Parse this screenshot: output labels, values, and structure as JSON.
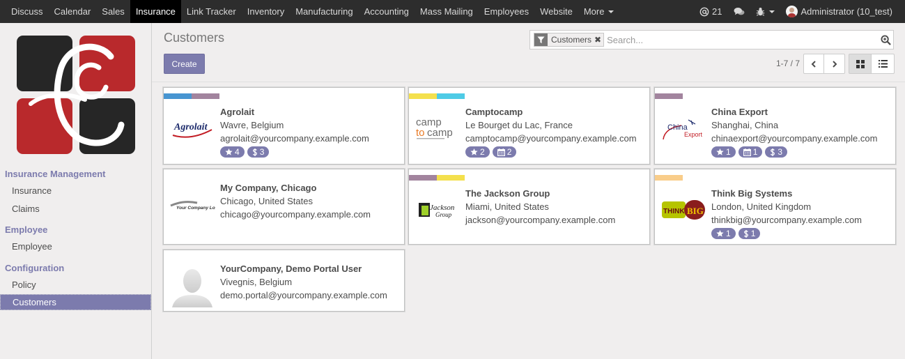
{
  "topbar": {
    "menu": [
      "Discuss",
      "Calendar",
      "Sales",
      "Insurance",
      "Link Tracker",
      "Inventory",
      "Manufacturing",
      "Accounting",
      "Mass Mailing",
      "Employees",
      "Website"
    ],
    "more_label": "More",
    "messages_count": "21",
    "user_label": "Administrator (10_test)"
  },
  "sidebar": {
    "sections": [
      {
        "title": "Insurance Management",
        "items": [
          "Insurance",
          "Claims"
        ]
      },
      {
        "title": "Employee",
        "items": [
          "Employee"
        ]
      },
      {
        "title": "Configuration",
        "items": [
          "Policy",
          "Customers"
        ]
      }
    ]
  },
  "control": {
    "breadcrumb": "Customers",
    "create_label": "Create",
    "facet_label": "Customers",
    "facet_remove": "✖",
    "search_placeholder": "Search...",
    "pager_value": "1-7 / 7"
  },
  "colors": {
    "accent": "#7c7bad",
    "topbar": "#2d2d2d"
  },
  "cards": [
    {
      "name": "Agrolait",
      "location": "Wavre, Belgium",
      "email": "agrolait@yourcompany.example.com",
      "tag_colors": [
        "#4795d1",
        "#a2849e"
      ],
      "logo": "Agrolait",
      "badges": [
        {
          "icon": "star-icon",
          "value": "4"
        },
        {
          "icon": "dollar-icon",
          "value": "3"
        }
      ]
    },
    {
      "name": "Camptocamp",
      "location": "Le Bourget du Lac, France",
      "email": "camptocamp@yourcompany.example.com",
      "tag_colors": [
        "#f4e04d",
        "#4ecbe6"
      ],
      "logo": "camptocamp",
      "badges": [
        {
          "icon": "star-icon",
          "value": "2"
        },
        {
          "icon": "calendar-icon",
          "value": "2"
        }
      ]
    },
    {
      "name": "China Export",
      "location": "Shanghai, China",
      "email": "chinaexport@yourcompany.example.com",
      "tag_colors": [
        "#a2849e"
      ],
      "logo": "ChinaExport",
      "badges": [
        {
          "icon": "star-icon",
          "value": "1"
        },
        {
          "icon": "calendar-icon",
          "value": "1"
        },
        {
          "icon": "dollar-icon",
          "value": "3"
        }
      ]
    },
    {
      "name": "My Company, Chicago",
      "location": "Chicago, United States",
      "email": "chicago@yourcompany.example.com",
      "tag_colors": [],
      "logo": "YourCompanyLogo",
      "badges": []
    },
    {
      "name": "The Jackson Group",
      "location": "Miami, United States",
      "email": "jackson@yourcompany.example.com",
      "tag_colors": [
        "#a2849e",
        "#f4e04d"
      ],
      "logo": "JacksonGroup",
      "badges": []
    },
    {
      "name": "Think Big Systems",
      "location": "London, United Kingdom",
      "email": "thinkbig@yourcompany.example.com",
      "tag_colors": [
        "#f9cd8a"
      ],
      "logo": "ThinkBig",
      "badges": [
        {
          "icon": "star-icon",
          "value": "1"
        },
        {
          "icon": "dollar-icon",
          "value": "1"
        }
      ]
    },
    {
      "name": "YourCompany, Demo Portal User",
      "location": "Vivegnis, Belgium",
      "email": "demo.portal@yourcompany.example.com",
      "tag_colors": [],
      "logo": "Avatar",
      "badges": []
    }
  ]
}
